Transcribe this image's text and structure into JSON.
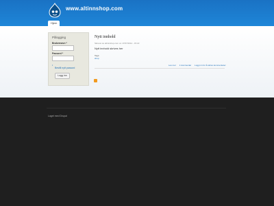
{
  "header": {
    "site_name": "www.altinnshop.com",
    "logo_icon": "drupal-drop-icon"
  },
  "nav": {
    "home_label": "Hjem"
  },
  "login": {
    "title": "Pålogging",
    "username_label": "Brukernavn *",
    "password_label": "Passord *",
    "new_password_link": "Bestill nytt passord",
    "submit_label": "Logg inn"
  },
  "post": {
    "title": "Nytt innhold",
    "meta": "Skrevet av altinnshop.com on 17/07/2014 - 15:22",
    "body": "Nytt innhold skrives her",
    "tags_label": "Tags:",
    "tag": "shop",
    "links": [
      "Les mer",
      "1 kommentar",
      "Logg inn for å skrive kommentarer"
    ]
  },
  "footer": {
    "text": "Laget med Drupal"
  },
  "colors": {
    "header": "#1a72c4",
    "link": "#1e6fb8",
    "footer_bg": "#1f1f1f"
  }
}
